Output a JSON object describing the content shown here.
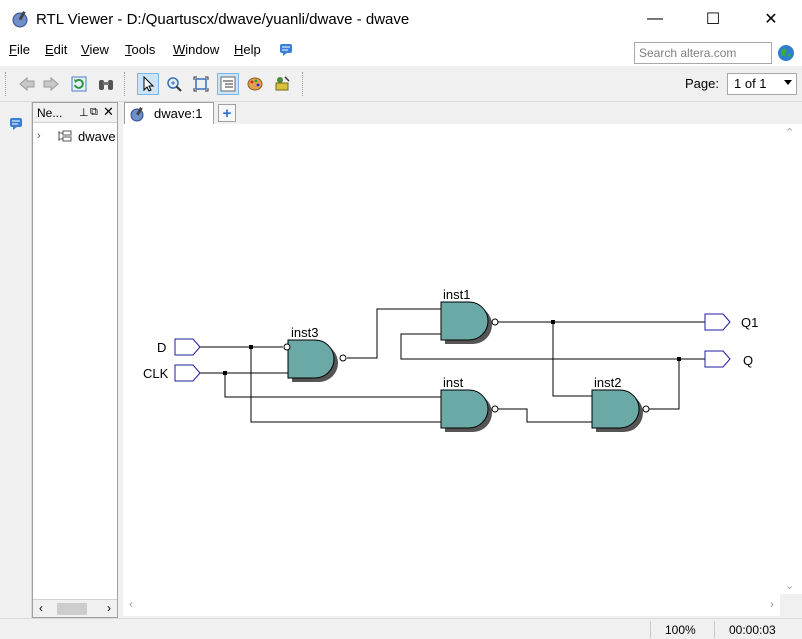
{
  "window": {
    "title": "RTL Viewer - D:/Quartuscx/dwave/yuanli/dwave - dwave",
    "minimize_glyph": "—",
    "maximize_glyph": "☐",
    "close_glyph": "✕"
  },
  "menu": {
    "items": [
      {
        "first": "F",
        "rest": "ile"
      },
      {
        "first": "E",
        "rest": "dit"
      },
      {
        "first": "V",
        "rest": "iew"
      },
      {
        "first": "T",
        "rest": "ools"
      },
      {
        "first": "W",
        "rest": "indow"
      },
      {
        "first": "H",
        "rest": "elp"
      }
    ]
  },
  "search": {
    "placeholder": "Search altera.com"
  },
  "toolbar": {
    "page_label": "Page:",
    "page_value": "1 of 1"
  },
  "navigator": {
    "title": "Ne...",
    "tree_item": "dwave"
  },
  "tabs": [
    {
      "label": "dwave:1"
    }
  ],
  "schematic": {
    "inputs": [
      "D",
      "CLK"
    ],
    "outputs": [
      "Q1",
      "Q"
    ],
    "instances": [
      "inst3",
      "inst1",
      "inst",
      "inst2"
    ],
    "fill_color": "#6aa9a6",
    "wire_color": "#000000",
    "port_color": "#1c1c9c"
  },
  "status": {
    "zoom": "100%",
    "time": "00:00:03"
  }
}
